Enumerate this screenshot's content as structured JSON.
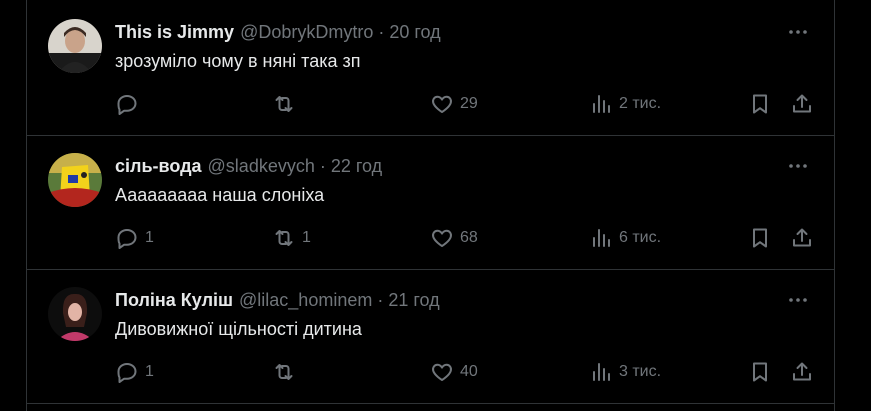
{
  "posts": [
    {
      "name": "This is Jimmy",
      "handle": "@DobrykDmytro",
      "time": "20 год",
      "text": "зрозуміло чому в няні така зп",
      "replies": "",
      "reposts": "",
      "likes": "29",
      "views": "2 тис."
    },
    {
      "name": "сіль-вода",
      "handle": "@sladkevych",
      "time": "22 год",
      "text": "Ааааааааа наша слоніха",
      "replies": "1",
      "reposts": "1",
      "likes": "68",
      "views": "6 тис."
    },
    {
      "name": "Поліна Куліш",
      "handle": "@lilac_hominem",
      "time": "21 год",
      "text": "Дивовижної щільності дитина",
      "replies": "1",
      "reposts": "",
      "likes": "40",
      "views": "3 тис."
    }
  ],
  "separator": "·",
  "colors": {
    "background": "#000000",
    "text": "#e7e9ea",
    "muted": "#71767b",
    "border": "#2f3336"
  },
  "icons": [
    "more-icon",
    "reply-icon",
    "repost-icon",
    "like-icon",
    "views-icon",
    "bookmark-icon",
    "share-icon"
  ]
}
